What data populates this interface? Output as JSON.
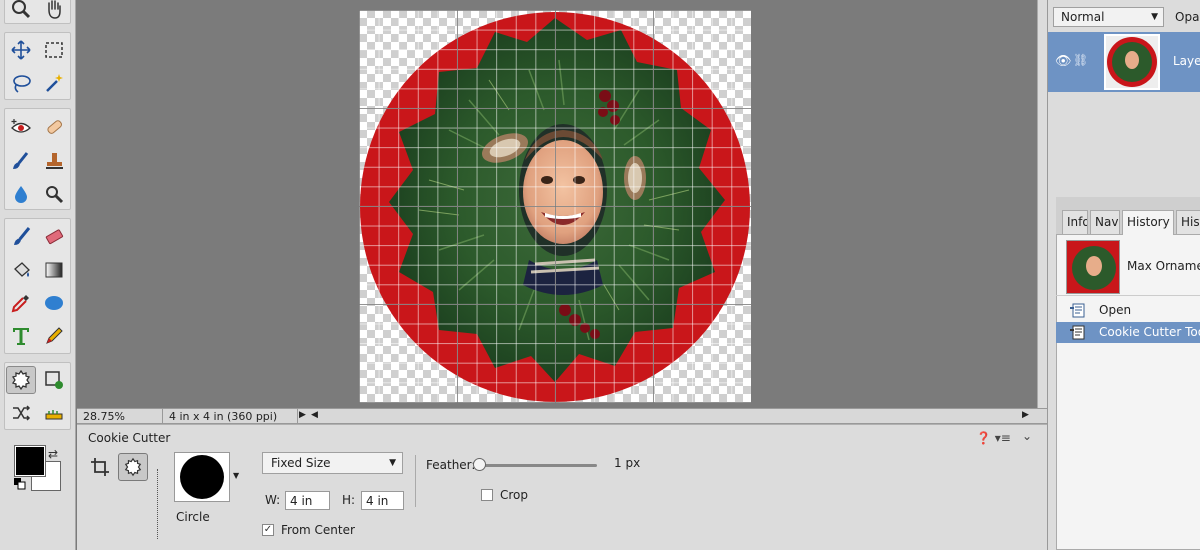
{
  "document": {
    "zoom": "28.75%",
    "doc_size": "4 in x 4 in (360 ppi)"
  },
  "options_bar": {
    "tool_name": "Cookie Cutter",
    "shape_label": "Circle",
    "size_mode": "Fixed Size",
    "width_label": "W:",
    "width_value": "4 in",
    "height_label": "H:",
    "height_value": "4 in",
    "from_center_label": "From Center",
    "from_center_checked": true,
    "feather_label": "Feather:",
    "feather_value": "1 px",
    "feather_fraction": 0.0,
    "crop_label": "Crop",
    "crop_checked": false
  },
  "layers_panel": {
    "blend_mode": "Normal",
    "opacity_label": "Opac",
    "layer_name": "Layer"
  },
  "history_panel": {
    "tabs": [
      {
        "label": "Info",
        "active": false
      },
      {
        "label": "Navi",
        "active": false
      },
      {
        "label": "History",
        "active": true
      },
      {
        "label": "Histo",
        "active": false
      }
    ],
    "snapshot_name": "Max Ornamen",
    "states": [
      {
        "label": "Open",
        "selected": false
      },
      {
        "label": "Cookie Cutter Tool",
        "selected": true
      }
    ]
  },
  "colors": {
    "accent": "#6e93c4",
    "wreath_red": "#c9161a",
    "foreground": "#000000",
    "background": "#ffffff"
  },
  "tool_icons": [
    "zoom-icon",
    "hand-icon",
    "move-icon",
    "marquee-icon",
    "lasso-icon",
    "magic-wand-icon",
    "red-eye-icon",
    "spot-healing-icon",
    "smart-brush-icon",
    "clone-stamp-icon",
    "blur-icon",
    "sponge-icon",
    "brush-icon",
    "eraser-icon",
    "paint-bucket-icon",
    "gradient-icon",
    "eyedropper-icon",
    "shape-icon",
    "type-icon",
    "pencil-icon",
    "cookie-cutter-icon",
    "recompose-icon",
    "content-aware-move-icon",
    "straighten-icon"
  ]
}
